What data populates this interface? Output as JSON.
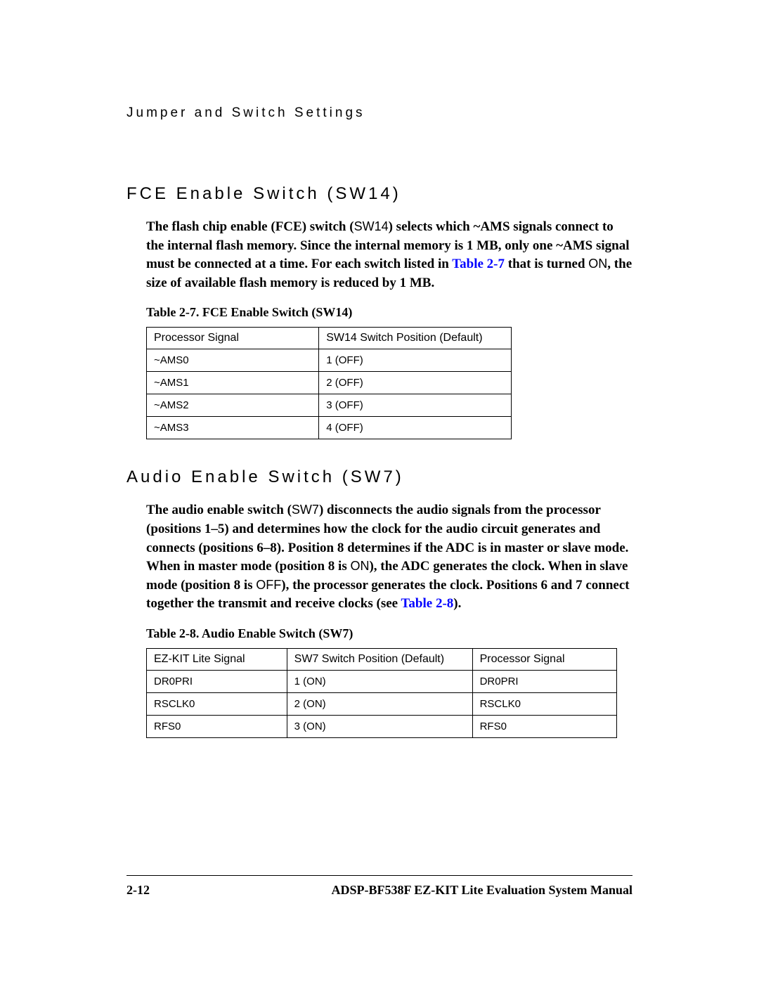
{
  "running_head": "Jumper and Switch Settings",
  "section1": {
    "title": "FCE Enable Switch (SW14)",
    "para_pre": "The flash chip enable (FCE) switch (",
    "mono1": "SW14",
    "para_mid1": ") selects which ~AMS signals connect to the internal flash memory. Since the internal memory is 1 MB, only one ~AMS signal must be connected at a time. For each switch listed in ",
    "link": "Table 2-7",
    "para_mid2": " that is turned ",
    "mono2": "ON",
    "para_end": ", the size of available flash memory is reduced by 1 MB.",
    "table_caption": "Table 2-7. FCE Enable Switch (SW14)",
    "table": {
      "headers": [
        "Processor Signal",
        "SW14 Switch Position (Default)"
      ],
      "rows": [
        {
          "sig": "~AMS0",
          "pos": "1",
          "def": " (OFF)"
        },
        {
          "sig": "~AMS1",
          "pos": "2",
          "def": " (OFF)"
        },
        {
          "sig": "~AMS2",
          "pos": "3",
          "def": " (OFF)"
        },
        {
          "sig": "~AMS3",
          "pos": "4",
          "def": " (OFF)"
        }
      ]
    }
  },
  "section2": {
    "title": "Audio Enable Switch (SW7)",
    "para_pre": "The audio enable switch (",
    "mono1": "SW7",
    "para_mid1": ") disconnects the audio signals from the processor (positions 1–5) and determines how the clock for the audio circuit generates and connects (positions 6–8). Position 8 determines if the ADC is in master or slave mode. When in master mode (position 8 is ",
    "mono2": "ON",
    "para_mid2": "), the ADC generates the clock. When in slave mode (position 8 is ",
    "mono3": "OFF",
    "para_mid3": "), the processor generates the clock. Positions 6 and 7 connect together the transmit and receive clocks (see ",
    "link": "Table 2-8",
    "para_end": ").",
    "table_caption": "Table 2-8. Audio Enable Switch (SW7)",
    "table": {
      "headers": [
        "EZ-KIT Lite Signal",
        "SW7 Switch Position (Default)",
        "Processor Signal"
      ],
      "rows": [
        {
          "ez": "DR0PRI",
          "pos": "1",
          "def": " (ON)",
          "proc": "DR0PRI"
        },
        {
          "ez": "RSCLK0",
          "pos": "2",
          "def": " (ON)",
          "proc": "RSCLK0"
        },
        {
          "ez": "RFS0",
          "pos": "3",
          "def": " (ON)",
          "proc": "RFS0"
        }
      ]
    }
  },
  "footer": {
    "page": "2-12",
    "book": "ADSP-BF538F EZ-KIT Lite Evaluation System Manual"
  }
}
